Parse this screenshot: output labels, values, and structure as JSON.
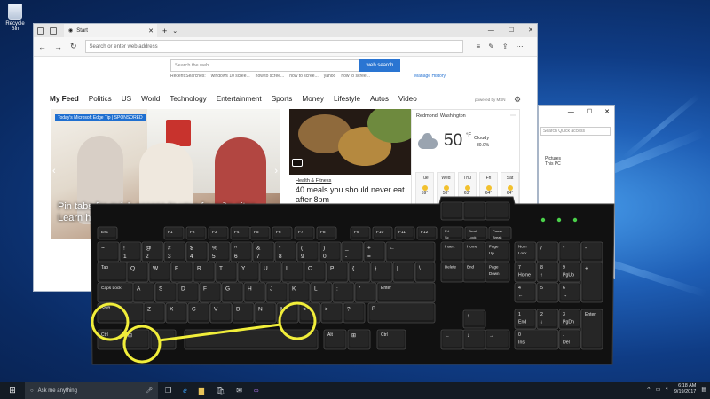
{
  "desktop": {
    "recycle_bin_label": "Recycle Bin"
  },
  "edge": {
    "tab_title": "Start",
    "address_placeholder": "Search or enter web address",
    "search_placeholder": "Search the web",
    "search_button": "web search",
    "recent_label": "Recent Searches:",
    "recent_items": [
      "windows 10 scree...",
      "how to scree...",
      "how to scree...",
      "yahoo",
      "how to scree..."
    ],
    "manage_history": "Manage History",
    "feed_tabs": [
      "My Feed",
      "Politics",
      "US",
      "World",
      "Technology",
      "Entertainment",
      "Sports",
      "Money",
      "Lifestyle",
      "Autos",
      "Video"
    ],
    "powered_by": "powered by MSN",
    "hero_tag": "Today's Microsoft Edge Tip | SPONSORED",
    "hero_caption": "Pin tabs for quick access to your favorite sites. Learn how",
    "food_category": "Health & Fitness",
    "food_headline": "40 meals you should never eat after 8pm",
    "weather": {
      "city": "Redmond, Washington",
      "temp": "50",
      "unit": "°F",
      "condition": "Cloudy",
      "precip": "80.0%",
      "forecast": [
        {
          "day": "Tue",
          "temp": "59°"
        },
        {
          "day": "Wed",
          "temp": "58°"
        },
        {
          "day": "Thu",
          "temp": "63°"
        },
        {
          "day": "Fri",
          "temp": "64°"
        },
        {
          "day": "Sat",
          "temp": "64°"
        }
      ]
    }
  },
  "explorer": {
    "search_placeholder": "Search Quick access",
    "item_title": "Pictures",
    "item_sub": "This PC"
  },
  "keyboard": {
    "fn_row": [
      "Esc",
      "F1",
      "F2",
      "F3",
      "F4",
      "F5",
      "F6",
      "F7",
      "F8",
      "F9",
      "F10",
      "F11",
      "F12"
    ],
    "sys_keys": [
      "Prt Sc SysRq",
      "Scroll Lock",
      "Pause Break"
    ],
    "num_row_top": [
      "~",
      "!",
      "@",
      "#",
      "$",
      "%",
      "^",
      "&",
      "*",
      "(",
      ")",
      "_",
      "+"
    ],
    "num_row_bottom": [
      "`",
      "1",
      "2",
      "3",
      "4",
      "5",
      "6",
      "7",
      "8",
      "9",
      "0",
      "-",
      "="
    ],
    "q_row": [
      "Tab",
      "Q",
      "W",
      "E",
      "R",
      "T",
      "Y",
      "U",
      "I",
      "O",
      "P",
      "{",
      "}",
      "|"
    ],
    "a_row": [
      "Caps Lock",
      "A",
      "S",
      "D",
      "F",
      "G",
      "H",
      "J",
      "K",
      "L",
      ":",
      "\"",
      "Enter"
    ],
    "z_row": [
      "Shift",
      "Z",
      "X",
      "C",
      "V",
      "B",
      "N",
      "M",
      "<",
      ">",
      "?",
      "P"
    ],
    "bottom_row": [
      "Ctrl",
      "Alt",
      "Alt",
      "Ctrl"
    ],
    "nav_keys": [
      "Insert",
      "Home",
      "Page Up",
      "Delete",
      "End",
      "Page Down"
    ],
    "numpad_top": [
      "Num Lock",
      "/",
      "*",
      "-"
    ],
    "numpad_7row": [
      "7 Home",
      "8 ↑",
      "9 PgUp"
    ],
    "numpad_4row": [
      "4 ←",
      "5",
      "6 →"
    ],
    "numpad_1row": [
      "1 End",
      "2 ↓",
      "3 PgDn"
    ],
    "numpad_0row": [
      "0 Ins",
      ". Del"
    ],
    "numpad_side": [
      "+",
      "Enter"
    ],
    "highlight_color": "#f1ee3a"
  },
  "taskbar": {
    "search_text": "Ask me anything",
    "time": "6:18 AM",
    "date": "9/19/2017"
  }
}
